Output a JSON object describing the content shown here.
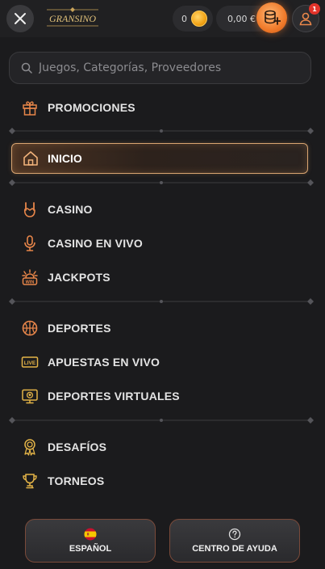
{
  "header": {
    "logo_text": "GRANSINO",
    "coins_value": "0",
    "balance_value": "0,00 €",
    "notification_count": "1",
    "icons": [
      "close-icon",
      "coin-icon",
      "deposit-icon",
      "user-icon"
    ]
  },
  "search": {
    "placeholder": "Juegos, Categorías, Proveedores",
    "icon": "search-icon"
  },
  "menu": {
    "promociones": "PROMOCIONES",
    "inicio": "INICIO",
    "casino": "CASINO",
    "casino_en_vivo": "CASINO EN VIVO",
    "jackpots": "JACKPOTS",
    "deportes": "DEPORTES",
    "apuestas_en_vivo": "APUESTAS EN VIVO",
    "deportes_virtuales": "DEPORTES VIRTUALES",
    "desafios": "DESAFÍOS",
    "torneos": "TORNEOS",
    "live_icon_text": "LIVE",
    "win_icon_text": "WIN"
  },
  "footer": {
    "language_label": "ESPAÑOL",
    "help_label": "CENTRO DE AYUDA"
  },
  "colors": {
    "accent": "#f07a2a",
    "icon_orange": "#e8864a",
    "icon_gold": "#e3b347",
    "active_border": "#d9a571",
    "background": "#1b1b1d"
  }
}
